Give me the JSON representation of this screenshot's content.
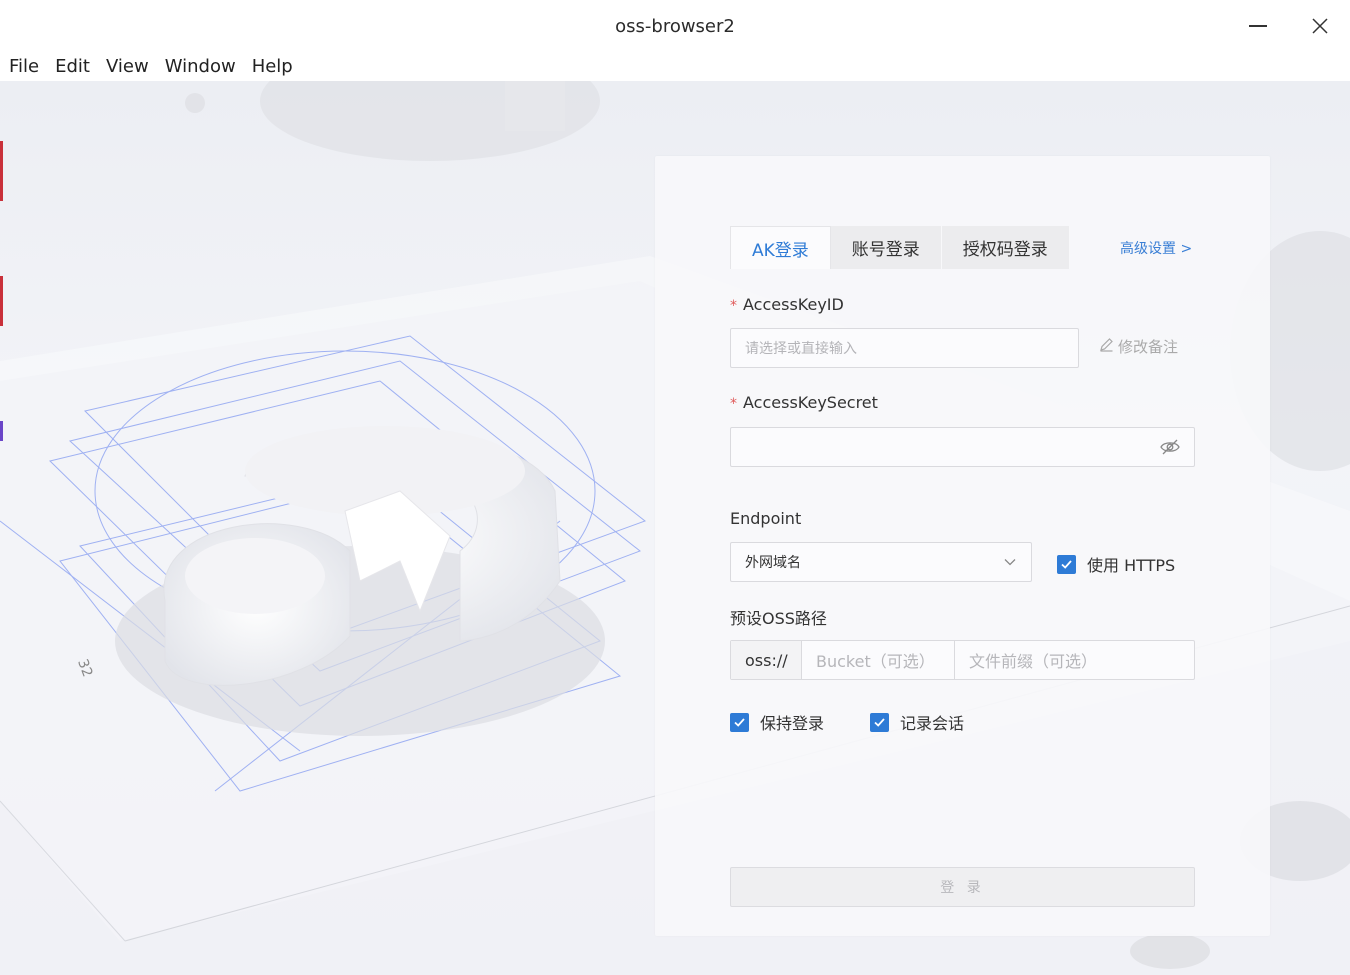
{
  "window": {
    "title": "oss-browser2",
    "minimize_icon": "minimize-icon",
    "close_icon": "close-icon"
  },
  "menu": [
    "File",
    "Edit",
    "View",
    "Window",
    "Help"
  ],
  "art": {
    "axis_label": "32"
  },
  "login": {
    "tabs": [
      {
        "label": "AK登录",
        "active": true
      },
      {
        "label": "账号登录",
        "active": false
      },
      {
        "label": "授权码登录",
        "active": false
      }
    ],
    "advanced_link": "高级设置 >",
    "access_key_id": {
      "required_mark": "*",
      "label": "AccessKeyID",
      "placeholder": "请选择或直接输入",
      "edit_note": "修改备注"
    },
    "access_key_secret": {
      "required_mark": "*",
      "label": "AccessKeySecret",
      "value": ""
    },
    "endpoint": {
      "label": "Endpoint",
      "selected": "外网域名",
      "use_https": {
        "label": "使用 HTTPS",
        "checked": true
      }
    },
    "preset_path": {
      "label": "预设OSS路径",
      "prefix": "oss://",
      "bucket_placeholder": "Bucket（可选）",
      "prefix_placeholder": "文件前缀（可选）"
    },
    "keep_login": {
      "label": "保持登录",
      "checked": true
    },
    "record_session": {
      "label": "记录会话",
      "checked": true
    },
    "submit_label": "登 录"
  },
  "colors": {
    "accent": "#2e7bd6",
    "required": "#e05a5a",
    "link": "#3a7fd5"
  }
}
